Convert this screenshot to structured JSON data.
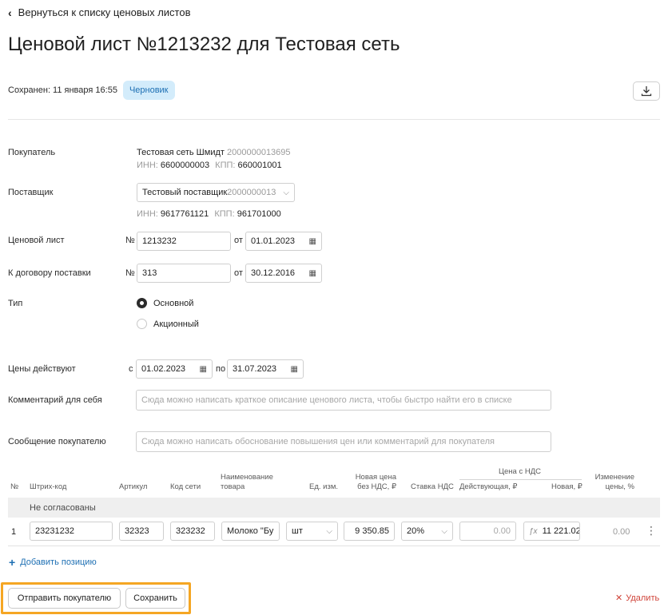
{
  "header": {
    "back_link": "Вернуться к списку ценовых листов",
    "title": "Ценовой лист №1213232 для Тестовая сеть",
    "saved_text": "Сохранен: 11 января 16:55",
    "status_badge": "Черновик"
  },
  "buyer": {
    "label": "Покупатель",
    "name": "Тестовая сеть Шмидт",
    "code": "2000000013695",
    "inn_label": "ИНН:",
    "inn": "6600000003",
    "kpp_label": "КПП:",
    "kpp": "660001001"
  },
  "supplier": {
    "label": "Поставщик",
    "selected": "Тестовый поставщик",
    "selected_code": "2000000013",
    "inn_label": "ИНН:",
    "inn": "9617761121",
    "kpp_label": "КПП:",
    "kpp": "961701000"
  },
  "price_list": {
    "label": "Ценовой лист",
    "num_prefix": "№",
    "number": "1213232",
    "from_label": "от",
    "date": "01.01.2023"
  },
  "contract": {
    "label": "К договору поставки",
    "num_prefix": "№",
    "number": "313",
    "from_label": "от",
    "date": "30.12.2016"
  },
  "type": {
    "label": "Тип",
    "options": [
      "Основной",
      "Акционный"
    ],
    "selected": "Основной"
  },
  "validity": {
    "label": "Цены действуют",
    "from_label": "с",
    "from": "01.02.2023",
    "to_label": "по",
    "to": "31.07.2023"
  },
  "comment_self": {
    "label": "Комментарий для себя",
    "placeholder": "Сюда можно написать краткое описание ценового листа, чтобы быстро найти его в списке"
  },
  "message_buyer": {
    "label": "Сообщение покупателю",
    "placeholder": "Сюда можно написать обоснование повышения цен или комментарий для покупателя"
  },
  "table": {
    "headers": {
      "num": "№",
      "barcode": "Штрих-код",
      "article": "Артикул",
      "net_code": "Код сети",
      "name": "Наименование товара",
      "unit": "Ед. изм.",
      "new_price_no_vat": "Новая цена без НДС, ₽",
      "vat_rate": "Ставка НДС",
      "price_with_vat": "Цена с НДС",
      "current": "Действующая, ₽",
      "new": "Новая, ₽",
      "change": "Изменение цены, %"
    },
    "group_label": "Не согласованы",
    "rows": [
      {
        "num": "1",
        "barcode": "23231232",
        "article": "32323",
        "net_code": "323232",
        "name": "Молоко \"Бу",
        "unit": "шт",
        "price_no_vat": "9 350.85",
        "vat": "20%",
        "current": "0.00",
        "fx": "ƒx",
        "new": "11 221.02",
        "change": "0.00"
      }
    ]
  },
  "actions": {
    "add_position": "Добавить позицию",
    "send_to_buyer": "Отправить покупателю",
    "save": "Сохранить",
    "delete": "Удалить"
  },
  "colors": {
    "accent": "#1d6fb3",
    "badge_bg": "#d3ecfb",
    "highlight": "#f5a623",
    "danger": "#d0443a"
  }
}
